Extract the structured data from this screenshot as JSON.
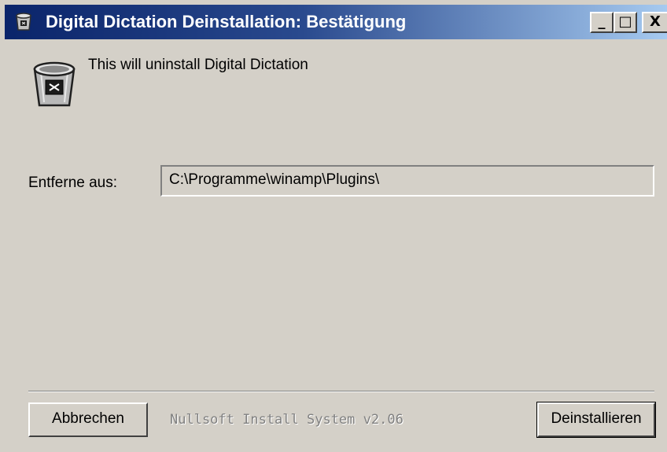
{
  "window": {
    "title": "Digital Dictation Deinstallation: Bestätigung",
    "minimize_label": "_",
    "maximize_label": "□",
    "close_label": "X"
  },
  "content": {
    "message": "This will uninstall Digital Dictation",
    "uninstall_from_label": "Entferne aus:",
    "uninstall_path": "C:\\Programme\\winamp\\Plugins\\"
  },
  "footer": {
    "cancel_label": "Abbrechen",
    "branding": "Nullsoft Install System v2.06",
    "uninstall_label": "Deinstallieren"
  },
  "icons": {
    "title_icon": "recycle-bin-icon",
    "main_icon": "recycle-bin-icon"
  },
  "colors": {
    "titlebar_start": "#0a246a",
    "titlebar_end": "#a6caf0",
    "dialog_bg": "#d4d0c8"
  }
}
